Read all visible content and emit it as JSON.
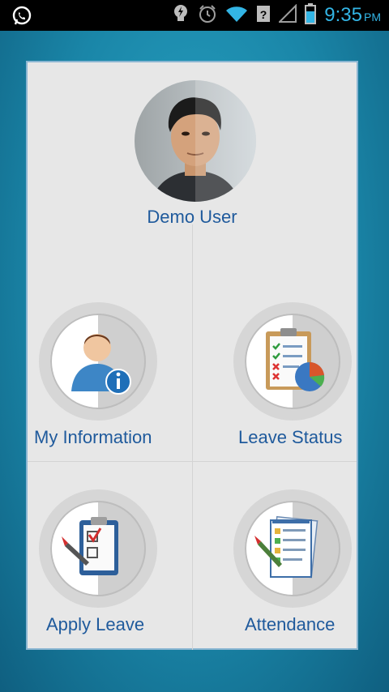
{
  "status_bar": {
    "time": "9:35",
    "ampm": "PM",
    "icons": [
      "whatsapp-icon",
      "lightbulb-icon",
      "alarm-icon",
      "wifi-icon",
      "unknown-sim-icon",
      "signal-icon",
      "battery-icon"
    ]
  },
  "profile": {
    "name": "Demo User"
  },
  "menu": {
    "my_information": "My Information",
    "leave_status": "Leave Status",
    "apply_leave": "Apply Leave",
    "attendance": "Attendance"
  },
  "colors": {
    "accent_text": "#1f5a9c",
    "status_time": "#33b5e5",
    "panel_bg": "#e7e7e7"
  }
}
